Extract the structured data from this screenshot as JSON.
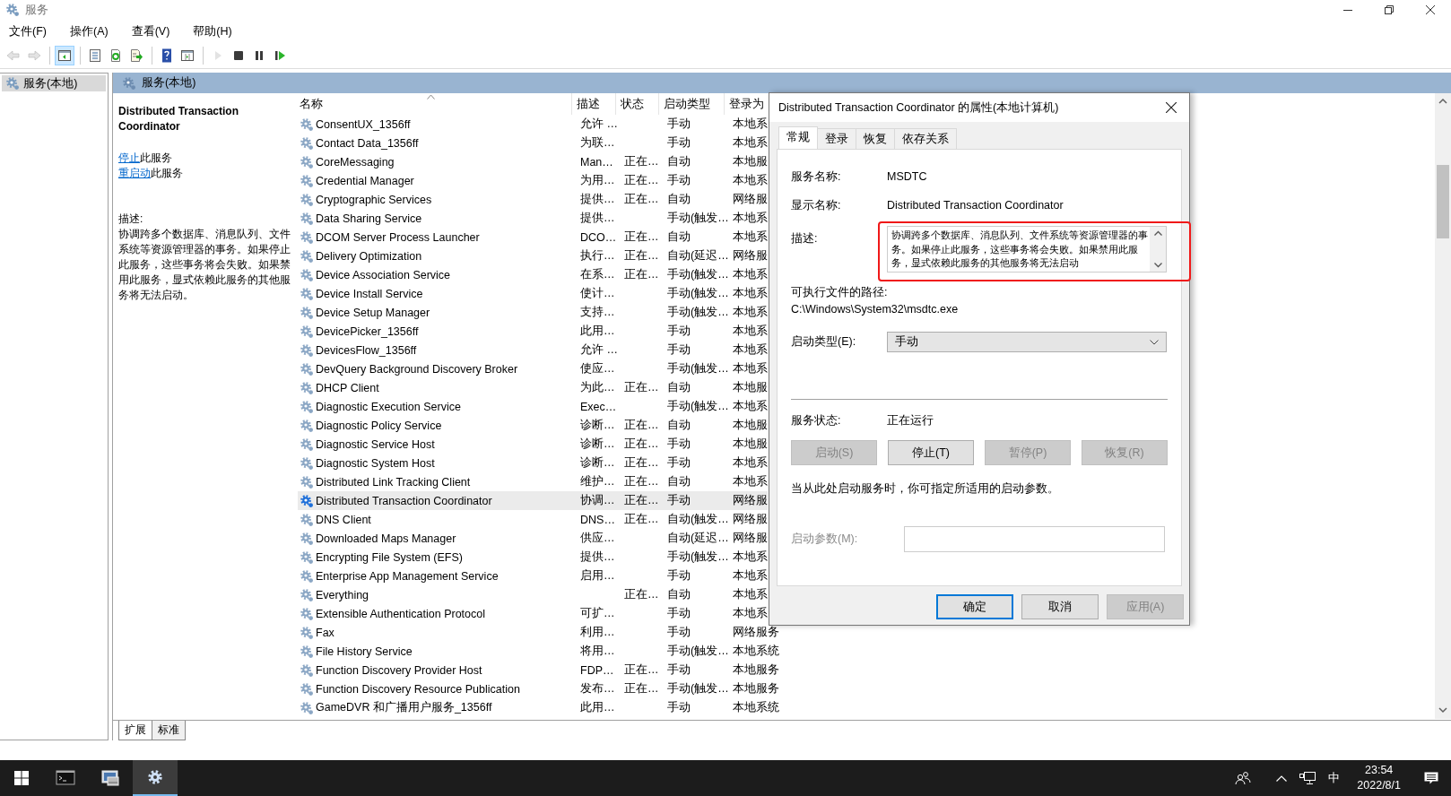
{
  "window": {
    "title": "服务"
  },
  "menu": [
    "文件(F)",
    "操作(A)",
    "查看(V)",
    "帮助(H)"
  ],
  "toolbar": [
    [
      {
        "kind": "back",
        "disabled": true,
        "selected": false
      },
      {
        "kind": "forward",
        "disabled": true,
        "selected": false
      }
    ],
    [
      {
        "kind": "console_tree",
        "disabled": false,
        "selected": true
      }
    ],
    [
      {
        "kind": "properties",
        "disabled": false,
        "selected": false
      },
      {
        "kind": "refresh",
        "disabled": false,
        "selected": false
      },
      {
        "kind": "export",
        "disabled": false,
        "selected": false
      }
    ],
    [
      {
        "kind": "help",
        "disabled": false,
        "selected": false
      },
      {
        "kind": "view",
        "disabled": false,
        "selected": false
      }
    ],
    [
      {
        "kind": "start",
        "disabled": true,
        "selected": false
      },
      {
        "kind": "stop",
        "disabled": false,
        "selected": false
      },
      {
        "kind": "pause",
        "disabled": false,
        "selected": false
      },
      {
        "kind": "restart",
        "disabled": false,
        "selected": false
      }
    ]
  ],
  "tree": {
    "items": [
      {
        "label": "服务(本地)",
        "selected": true
      }
    ]
  },
  "header": {
    "title": "服务(本地)"
  },
  "details": {
    "title": "Distributed Transaction Coordinator",
    "actions": [
      {
        "link": "停止",
        "rest": "此服务"
      },
      {
        "link": "重启动",
        "rest": "此服务"
      }
    ],
    "description_label": "描述:",
    "description": "协调跨多个数据库、消息队列、文件系统等资源管理器的事务。如果停止此服务，这些事务将会失败。如果禁用此服务，显式依赖此服务的其他服务将无法启动。"
  },
  "table": {
    "columns": [
      {
        "label": "名称",
        "sorted": true
      },
      {
        "label": "描述",
        "sorted": false
      },
      {
        "label": "状态",
        "sorted": false
      },
      {
        "label": "启动类型",
        "sorted": false
      },
      {
        "label": "登录为",
        "sorted": false
      }
    ],
    "rows": [
      {
        "name": "ConsentUX_1356ff",
        "description": "允许 …",
        "startup": "手动",
        "logon": "本地系",
        "selected": false
      },
      {
        "name": "Contact Data_1356ff",
        "description": "为联…",
        "startup": "手动",
        "logon": "本地系",
        "selected": false
      },
      {
        "name": "CoreMessaging",
        "description": "Man…",
        "status": "正在…",
        "startup": "自动",
        "logon": "本地服",
        "selected": false
      },
      {
        "name": "Credential Manager",
        "description": "为用…",
        "status": "正在…",
        "startup": "手动",
        "logon": "本地系",
        "selected": false
      },
      {
        "name": "Cryptographic Services",
        "description": "提供…",
        "status": "正在…",
        "startup": "自动",
        "logon": "网络服",
        "selected": false
      },
      {
        "name": "Data Sharing Service",
        "description": "提供…",
        "startup": "手动(触发…",
        "logon": "本地系",
        "selected": false
      },
      {
        "name": "DCOM Server Process Launcher",
        "description": "DCO…",
        "status": "正在…",
        "startup": "自动",
        "logon": "本地系",
        "selected": false
      },
      {
        "name": "Delivery Optimization",
        "description": "执行…",
        "status": "正在…",
        "startup": "自动(延迟…",
        "logon": "网络服",
        "selected": false
      },
      {
        "name": "Device Association Service",
        "description": "在系…",
        "status": "正在…",
        "startup": "手动(触发…",
        "logon": "本地系",
        "selected": false
      },
      {
        "name": "Device Install Service",
        "description": "使计…",
        "startup": "手动(触发…",
        "logon": "本地系",
        "selected": false
      },
      {
        "name": "Device Setup Manager",
        "description": "支持…",
        "startup": "手动(触发…",
        "logon": "本地系",
        "selected": false
      },
      {
        "name": "DevicePicker_1356ff",
        "description": "此用…",
        "startup": "手动",
        "logon": "本地系",
        "selected": false
      },
      {
        "name": "DevicesFlow_1356ff",
        "description": "允许 …",
        "startup": "手动",
        "logon": "本地系",
        "selected": false
      },
      {
        "name": "DevQuery Background Discovery Broker",
        "description": "使应…",
        "startup": "手动(触发…",
        "logon": "本地系",
        "selected": false
      },
      {
        "name": "DHCP Client",
        "description": "为此…",
        "status": "正在…",
        "startup": "自动",
        "logon": "本地服",
        "selected": false
      },
      {
        "name": "Diagnostic Execution Service",
        "description": "Exec…",
        "startup": "手动(触发…",
        "logon": "本地系",
        "selected": false
      },
      {
        "name": "Diagnostic Policy Service",
        "description": "诊断…",
        "status": "正在…",
        "startup": "自动",
        "logon": "本地服",
        "selected": false
      },
      {
        "name": "Diagnostic Service Host",
        "description": "诊断…",
        "status": "正在…",
        "startup": "手动",
        "logon": "本地服",
        "selected": false
      },
      {
        "name": "Diagnostic System Host",
        "description": "诊断…",
        "status": "正在…",
        "startup": "手动",
        "logon": "本地系",
        "selected": false
      },
      {
        "name": "Distributed Link Tracking Client",
        "description": "维护…",
        "status": "正在…",
        "startup": "自动",
        "logon": "本地系",
        "selected": false
      },
      {
        "name": "Distributed Transaction Coordinator",
        "description": "协调…",
        "status": "正在…",
        "startup": "手动",
        "logon": "网络服",
        "selected": true
      },
      {
        "name": "DNS Client",
        "description": "DNS…",
        "status": "正在…",
        "startup": "自动(触发…",
        "logon": "网络服",
        "selected": false
      },
      {
        "name": "Downloaded Maps Manager",
        "description": "供应…",
        "startup": "自动(延迟…",
        "logon": "网络服",
        "selected": false
      },
      {
        "name": "Encrypting File System (EFS)",
        "description": "提供…",
        "startup": "手动(触发…",
        "logon": "本地系",
        "selected": false
      },
      {
        "name": "Enterprise App Management Service",
        "description": "启用…",
        "startup": "手动",
        "logon": "本地系",
        "selected": false
      },
      {
        "name": "Everything",
        "status": "正在…",
        "startup": "自动",
        "logon": "本地系",
        "selected": false
      },
      {
        "name": "Extensible Authentication Protocol",
        "description": "可扩…",
        "startup": "手动",
        "logon": "本地系",
        "selected": false
      },
      {
        "name": "Fax",
        "description": "利用…",
        "startup": "手动",
        "logon": "网络服务",
        "selected": false
      },
      {
        "name": "File History Service",
        "description": "将用…",
        "startup": "手动(触发…",
        "logon": "本地系统",
        "selected": false
      },
      {
        "name": "Function Discovery Provider Host",
        "description": "FDP…",
        "status": "正在…",
        "startup": "手动",
        "logon": "本地服务",
        "selected": false
      },
      {
        "name": "Function Discovery Resource Publication",
        "description": "发布…",
        "status": "正在…",
        "startup": "手动(触发…",
        "logon": "本地服务",
        "selected": false
      },
      {
        "name": "GameDVR 和广播用户服务_1356ff",
        "description": "此用…",
        "startup": "手动",
        "logon": "本地系统",
        "selected": false
      }
    ]
  },
  "view_tabs": [
    {
      "label": "扩展",
      "selected": true
    },
    {
      "label": "标准",
      "selected": false
    }
  ],
  "dialog": {
    "title": "Distributed Transaction Coordinator 的属性(本地计算机)",
    "tabs": [
      {
        "label": "常规",
        "selected": true
      },
      {
        "label": "登录",
        "selected": false
      },
      {
        "label": "恢复",
        "selected": false
      },
      {
        "label": "依存关系",
        "selected": false
      }
    ],
    "fields": [
      {
        "label": "服务名称:",
        "value": "MSDTC"
      },
      {
        "label": "显示名称:",
        "value": "Distributed Transaction Coordinator"
      }
    ],
    "description": {
      "label": "描述:",
      "value": "协调跨多个数据库、消息队列、文件系统等资源管理器的事务。如果停止此服务，这些事务将会失败。如果禁用此服务，显式依赖此服务的其他服务将无法启动",
      "highlighted": true
    },
    "path": {
      "label": "可执行文件的路径:",
      "value": "C:\\Windows\\System32\\msdtc.exe"
    },
    "startup_type": {
      "label": "启动类型(E):",
      "value": "手动"
    },
    "status": {
      "label": "服务状态:",
      "value": "正在运行"
    },
    "service_buttons": [
      {
        "label": "启动(S)",
        "disabled": true
      },
      {
        "label": "停止(T)",
        "disabled": false
      },
      {
        "label": "暂停(P)",
        "disabled": true
      },
      {
        "label": "恢复(R)",
        "disabled": true
      }
    ],
    "note": "当从此处启动服务时，你可指定所适用的启动参数。",
    "parameters": {
      "label": "启动参数(M):",
      "disabled": true
    },
    "buttons": [
      {
        "label": "确定",
        "default": true,
        "disabled": false
      },
      {
        "label": "取消",
        "default": false,
        "disabled": false
      },
      {
        "label": "应用(A)",
        "default": false,
        "disabled": true
      }
    ]
  },
  "taskbar": {
    "apps": [
      {
        "selected": false
      },
      {
        "selected": false
      },
      {
        "selected": true
      }
    ],
    "ime": "中",
    "time": "23:54",
    "date": "2022/8/1"
  }
}
